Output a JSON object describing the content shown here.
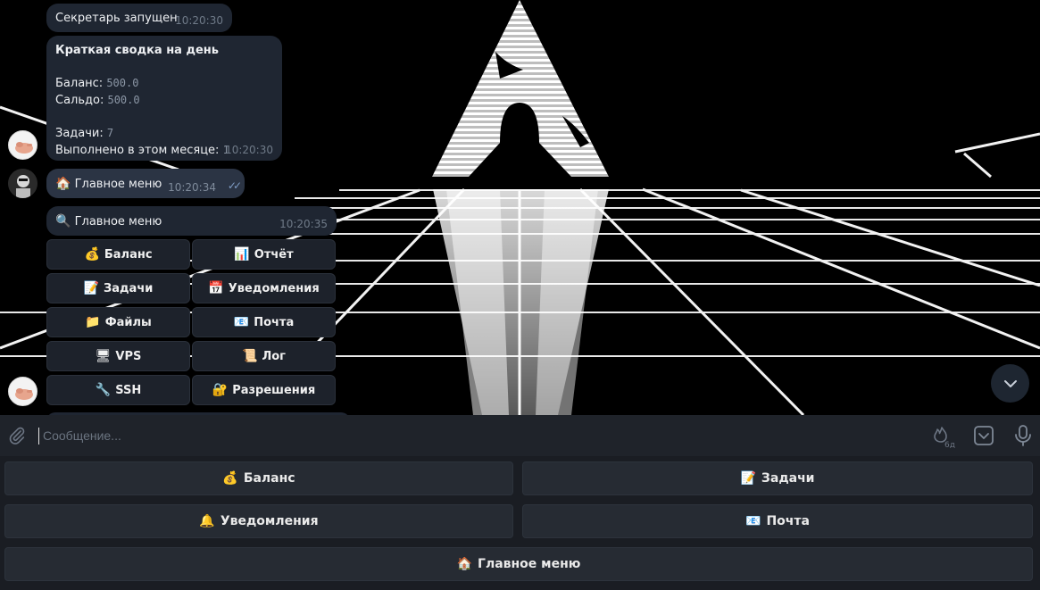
{
  "messages": {
    "status": {
      "text": "Секретарь запущен",
      "time": "10:20:30"
    },
    "summary": {
      "title": "Краткая сводка на день",
      "balance_label": "Баланс:",
      "balance_value": "500.0",
      "saldo_label": "Сальдо:",
      "saldo_value": "500.0",
      "tasks_label": "Задачи:",
      "tasks_value": "7",
      "done_label": "Выполнено в этом месяце:",
      "done_value": "1",
      "time": "10:20:30"
    },
    "user_cmd": {
      "emoji": "🏠",
      "text": "Главное меню",
      "time": "10:20:34"
    },
    "menu_reply": {
      "emoji": "🔍",
      "text": "Главное меню",
      "time": "10:20:35"
    }
  },
  "inline_keyboard": [
    {
      "emoji": "💰",
      "label": "Баланс"
    },
    {
      "emoji": "📊",
      "label": "Отчёт"
    },
    {
      "emoji": "📝",
      "label": "Задачи"
    },
    {
      "emoji": "📅",
      "label": "Уведомления"
    },
    {
      "emoji": "📁",
      "label": "Файлы"
    },
    {
      "emoji": "📧",
      "label": "Почта"
    },
    {
      "emoji": "🖥",
      "label": "VPS"
    },
    {
      "emoji": "📜",
      "label": "Лог"
    },
    {
      "emoji": "🔧",
      "label": "SSH"
    },
    {
      "emoji": "🔐",
      "label": "Разрешения"
    }
  ],
  "composer": {
    "placeholder": "Сообщение...",
    "timer_badge": "6д",
    "icons": [
      "paperclip-icon",
      "timer-fire-icon",
      "bot-keyboard-icon",
      "microphone-icon"
    ]
  },
  "reply_keyboard": [
    {
      "emoji": "💰",
      "label": "Баланс"
    },
    {
      "emoji": "📝",
      "label": "Задачи"
    },
    {
      "emoji": "🔔",
      "label": "Уведомления"
    },
    {
      "emoji": "📧",
      "label": "Почта"
    },
    {
      "emoji": "🏠",
      "label": "Главное меню"
    }
  ],
  "colors": {
    "incoming_bubble": "#1f2632",
    "outgoing_bubble": "#2b3444",
    "read_ticks": "#7f9cc4",
    "timestamp": "#6f7a88"
  }
}
